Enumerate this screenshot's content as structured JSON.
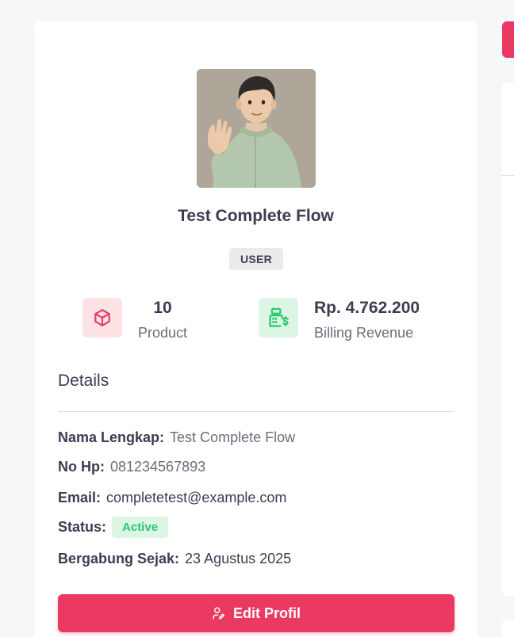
{
  "profile": {
    "name": "Test Complete Flow",
    "role": "USER"
  },
  "stats": {
    "product": {
      "value": "10",
      "label": "Product",
      "icon": "cube-icon"
    },
    "billing": {
      "value": "Rp. 4.762.200",
      "label": "Billing Revenue",
      "icon": "cash-register-dollar-icon"
    }
  },
  "details": {
    "title": "Details",
    "full_name": {
      "label": "Nama Lengkap:",
      "value": "Test Complete Flow"
    },
    "phone": {
      "label": "No Hp:",
      "value": "081234567893"
    },
    "email": {
      "label": "Email:",
      "value": "completetest@example.com"
    },
    "status": {
      "label": "Status:",
      "value": "Active"
    },
    "joined": {
      "label": "Bergabung Sejak:",
      "value": "23 Agustus 2025"
    }
  },
  "actions": {
    "edit_label": "Edit Profil",
    "edit_icon": "user-edit-icon"
  },
  "colors": {
    "primary": "#ea3a62",
    "success": "#28c76f",
    "success_bg": "#dcf5e5",
    "danger_bg": "#fde2e6"
  }
}
